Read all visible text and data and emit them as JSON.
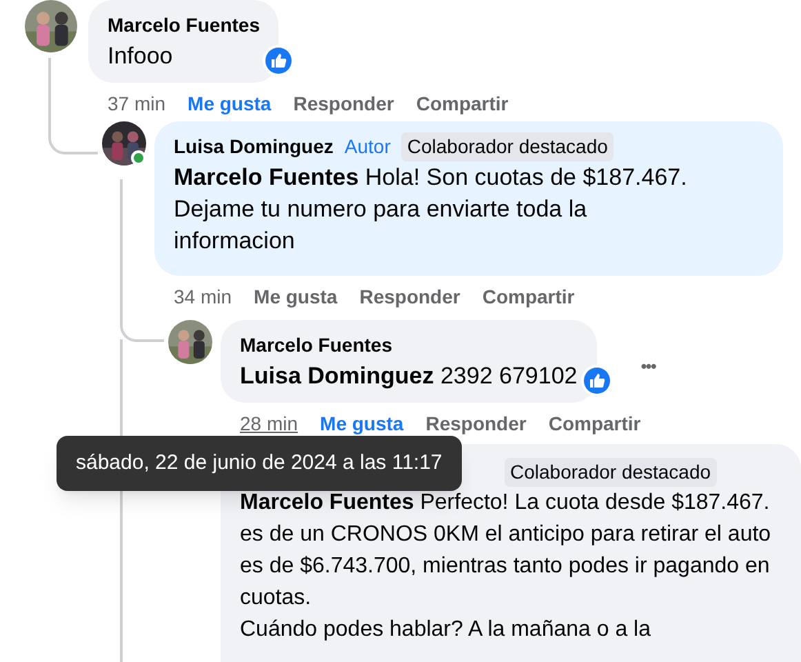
{
  "comments": [
    {
      "author": "Marcelo Fuentes",
      "color": "#f0f2f5",
      "text": "Infooo",
      "liked": true,
      "time": "37 min",
      "time_hovered": false,
      "actions": [
        {
          "label": "Me gusta",
          "selected": true
        },
        {
          "label": "Responder",
          "selected": false
        },
        {
          "label": "Compartir",
          "selected": false
        }
      ]
    },
    {
      "author": "Luisa Dominguez",
      "role": "Autor",
      "badge": "Colaborador destacado",
      "color": "#e7f3ff",
      "online": true,
      "mention": "Marcelo Fuentes",
      "text": "Hola! Son cuotas de $187.467. Dejame tu numero para enviarte toda la informacion",
      "liked": false,
      "time": "34 min",
      "time_hovered": false,
      "actions": [
        {
          "label": "Me gusta",
          "selected": false
        },
        {
          "label": "Responder",
          "selected": false
        },
        {
          "label": "Compartir",
          "selected": false
        }
      ]
    },
    {
      "author": "Marcelo Fuentes",
      "color": "#f0f2f5",
      "mention": "Luisa Dominguez",
      "text": "2392 679102",
      "liked": true,
      "time": "28 min",
      "time_hovered": true,
      "actions": [
        {
          "label": "Me gusta",
          "selected": true
        },
        {
          "label": "Responder",
          "selected": false
        },
        {
          "label": "Compartir",
          "selected": false
        }
      ],
      "more_button": "•••"
    },
    {
      "badge": "Colaborador destacado",
      "color": "#f0f2f5",
      "mention": "Marcelo Fuentes",
      "text": "Perfecto! La cuota desde $187.467. es de un CRONOS 0KM el anticipo para retirar el auto es de $6.743.700, mientras tanto podes ir pagando en cuotas.\nCuándo podes hablar? A la mañana o a la"
    }
  ],
  "tooltip": {
    "text": "sábado, 22 de junio de 2024 a las 11:17"
  }
}
